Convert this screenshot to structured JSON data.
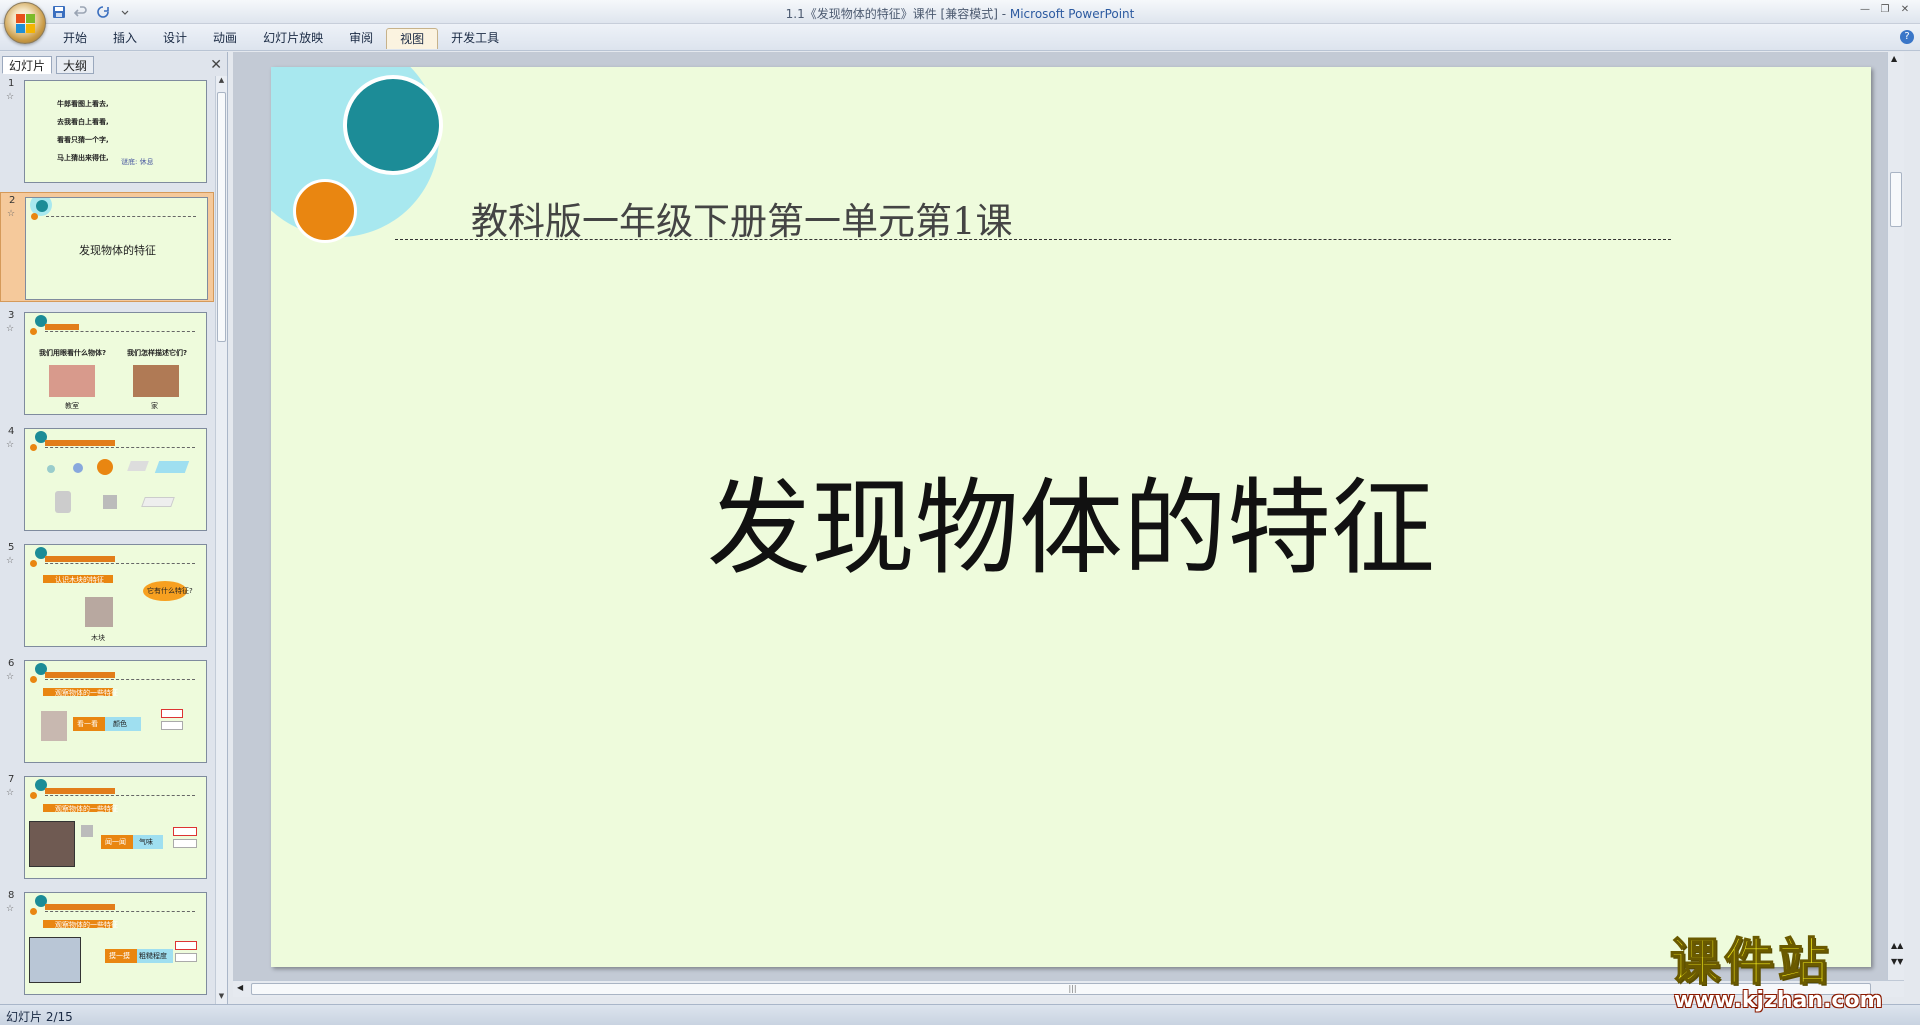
{
  "window": {
    "title": "1.1《发现物体的特征》课件 [兼容模式] - ",
    "app_name": "Microsoft PowerPoint"
  },
  "ribbon": {
    "tabs": [
      "开始",
      "插入",
      "设计",
      "动画",
      "幻灯片放映",
      "审阅",
      "视图",
      "开发工具"
    ],
    "active_tab": "视图"
  },
  "left_panel": {
    "tab_slides": "幻灯片",
    "tab_outline": "大纲",
    "active_tab": "幻灯片",
    "thumbnails": [
      {
        "num": "1",
        "lines": [
          "牛郎看图上看去,",
          "去我看白上看看,",
          "看看只猜一个字,",
          "马上猜出来得住,"
        ],
        "note": "谜底: 休息"
      },
      {
        "num": "2",
        "title": "发现物体的特征",
        "selected": true
      },
      {
        "num": "3",
        "left_text": "我们用眼看什么物体?",
        "right_text": "我们怎样描述它们?",
        "cap_left": "教室",
        "cap_right": "家"
      },
      {
        "num": "4"
      },
      {
        "num": "5",
        "label": "认识木块的特征",
        "bubble": "它有什么特征?",
        "caption": "木块"
      },
      {
        "num": "6",
        "label": "观察物体的一些特征",
        "action": "看一看",
        "result": "颜色"
      },
      {
        "num": "7",
        "label": "观察物体的一些特征",
        "action": "闻一闻",
        "result": "气味"
      },
      {
        "num": "8",
        "label": "观察物体的一些特征",
        "action": "摸一摸",
        "result": "粗糙程度"
      }
    ]
  },
  "slide": {
    "subtitle": "教科版一年级下册第一单元第1课",
    "title": "发现物体的特征"
  },
  "watermark": {
    "text": "课件站",
    "url": "www.kjzhan.com"
  },
  "status": {
    "slide_counter": "幻灯片 2/15"
  },
  "colors": {
    "slide_bg": "#eefbdc",
    "teal": "#1c8c97",
    "light_cyan": "#a8e8ef",
    "orange": "#e98611"
  }
}
